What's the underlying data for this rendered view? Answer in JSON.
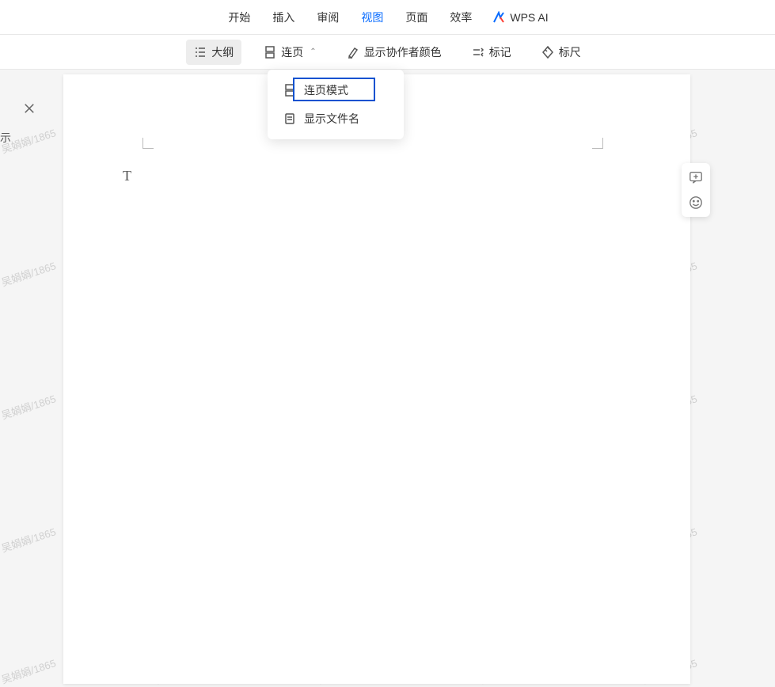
{
  "menubar": {
    "items": [
      {
        "label": "开始"
      },
      {
        "label": "插入"
      },
      {
        "label": "审阅"
      },
      {
        "label": "视图"
      },
      {
        "label": "页面"
      },
      {
        "label": "效率"
      }
    ],
    "wps_ai_label": "WPS AI"
  },
  "toolbar": {
    "outline_label": "大纲",
    "continuous_page_label": "连页",
    "show_collaborator_color_label": "显示协作者颜色",
    "marks_label": "标记",
    "ruler_label": "标尺"
  },
  "dropdown": {
    "continuous_mode_label": "连页模式",
    "show_filename_label": "显示文件名"
  },
  "sidebar": {
    "partial_text": "示"
  },
  "page": {
    "cursor_placeholder": "T"
  },
  "watermark_text": "吴娟娟/1865"
}
